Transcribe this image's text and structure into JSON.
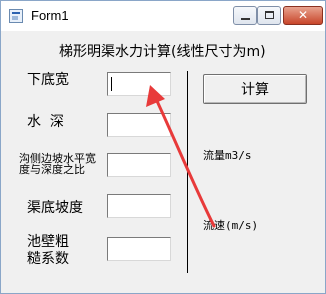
{
  "window": {
    "title": "Form1",
    "close_glyph": "✕"
  },
  "form": {
    "heading": "梯形明渠水力计算(线性尺寸为m)",
    "labels": {
      "bottom_width": "下底宽",
      "water_depth": "水  深",
      "slope_ratio": "沟侧边坡水平宽度与深度之比",
      "bed_slope": "渠底坡度",
      "roughness": "池壁粗糙系数"
    },
    "inputs": {
      "bottom_width": "",
      "water_depth": "",
      "slope_ratio": "",
      "bed_slope": "",
      "roughness": ""
    },
    "calculate_label": "计算",
    "flow_label": "流量m3/s",
    "velocity_label": "流速(m/s)"
  },
  "annotation": {
    "arrow_color": "#e83a3a"
  }
}
